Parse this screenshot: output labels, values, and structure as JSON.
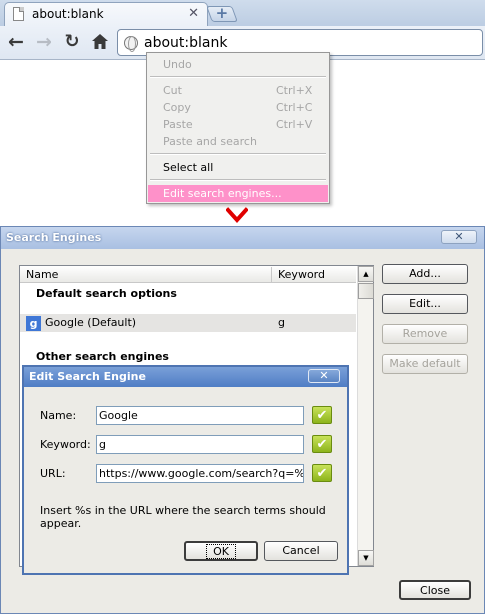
{
  "browser": {
    "tab_title": "about:blank",
    "tab_close": "✕",
    "newtab_label": "+",
    "url": "about:blank"
  },
  "context_menu": {
    "items": [
      {
        "label": "Undo",
        "shortcut": "",
        "state": "disabled"
      },
      {
        "label": "Cut",
        "shortcut": "Ctrl+X",
        "state": "disabled"
      },
      {
        "label": "Copy",
        "shortcut": "Ctrl+C",
        "state": "disabled"
      },
      {
        "label": "Paste",
        "shortcut": "Ctrl+V",
        "state": "disabled"
      },
      {
        "label": "Paste and search",
        "shortcut": "",
        "state": "disabled"
      },
      {
        "label": "Select all",
        "shortcut": "",
        "state": "enabled"
      },
      {
        "label": "Edit search engines...",
        "shortcut": "",
        "state": "highlighted"
      }
    ]
  },
  "search_engines_dialog": {
    "title": "Search Engines",
    "close_label": "✕",
    "columns": {
      "name": "Name",
      "keyword": "Keyword"
    },
    "default_group": "Default search options",
    "other_group": "Other search engines",
    "rows": [
      {
        "icon": "g",
        "name": "Google (Default)",
        "keyword": "g"
      }
    ],
    "buttons": {
      "add": "Add...",
      "edit": "Edit...",
      "remove": "Remove",
      "make_default": "Make default",
      "close": "Close"
    }
  },
  "edit_dialog": {
    "title": "Edit Search Engine",
    "close_label": "✕",
    "fields": {
      "name_label": "Name:",
      "name_value": "Google",
      "keyword_label": "Keyword:",
      "keyword_value": "g",
      "url_label": "URL:",
      "url_value": "https://www.google.com/search?q=%s"
    },
    "hint": "Insert %s in the URL where the search terms should appear.",
    "buttons": {
      "ok": "OK",
      "cancel": "Cancel"
    }
  },
  "colors": {
    "menu_highlight": "#fe91c9",
    "arrow": "#e00000",
    "valid_check": "#9cc22a"
  }
}
